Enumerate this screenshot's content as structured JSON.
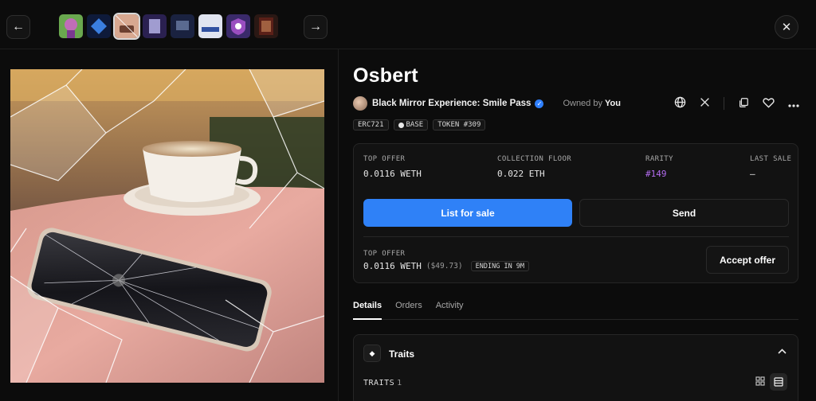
{
  "nav": {
    "prev_icon": "arrow-left-icon",
    "next_icon": "arrow-right-icon",
    "close_icon": "close-icon",
    "thumbnails": [
      {
        "name": "thumb-1",
        "colors": [
          "#6aa84f",
          "#c06db8"
        ]
      },
      {
        "name": "thumb-2",
        "colors": [
          "#0e1a3a",
          "#3a7ee0"
        ]
      },
      {
        "name": "thumb-3",
        "colors": [
          "#d8a890",
          "#6c4030"
        ],
        "selected": true
      },
      {
        "name": "thumb-4",
        "colors": [
          "#2a2050",
          "#a09cd0"
        ]
      },
      {
        "name": "thumb-5",
        "colors": [
          "#1a2240",
          "#5a6a90"
        ]
      },
      {
        "name": "thumb-6",
        "colors": [
          "#e0e4f0",
          "#3050a0"
        ]
      },
      {
        "name": "thumb-7",
        "colors": [
          "#3a2a6a",
          "#9a4ec0"
        ]
      },
      {
        "name": "thumb-8",
        "colors": [
          "#5a2018",
          "#a06040"
        ]
      }
    ]
  },
  "item": {
    "name": "Osbert",
    "collection": "Black Mirror Experience: Smile Pass",
    "owned_by_label": "Owned by",
    "owner": "You",
    "chips": [
      "ERC721",
      "BASE",
      "TOKEN #309"
    ]
  },
  "stats": {
    "top_offer": {
      "label": "TOP OFFER",
      "value": "0.0116 WETH"
    },
    "floor": {
      "label": "COLLECTION FLOOR",
      "value": "0.022 ETH"
    },
    "rarity": {
      "label": "RARITY",
      "value": "#149"
    },
    "last_sale": {
      "label": "LAST SALE",
      "value": "–"
    }
  },
  "actions": {
    "list": "List for sale",
    "send": "Send",
    "accept": "Accept offer"
  },
  "offer": {
    "label": "TOP OFFER",
    "value": "0.0116 WETH",
    "usd": "($49.73)",
    "ending": "ENDING IN 9M"
  },
  "tabs": [
    "Details",
    "Orders",
    "Activity"
  ],
  "traits": {
    "title": "Traits",
    "count_label": "TRAITS",
    "count": "1"
  },
  "colors": {
    "accent": "#2f81f7",
    "rarity": "#b36cf0",
    "verified": "#2f80ff"
  }
}
